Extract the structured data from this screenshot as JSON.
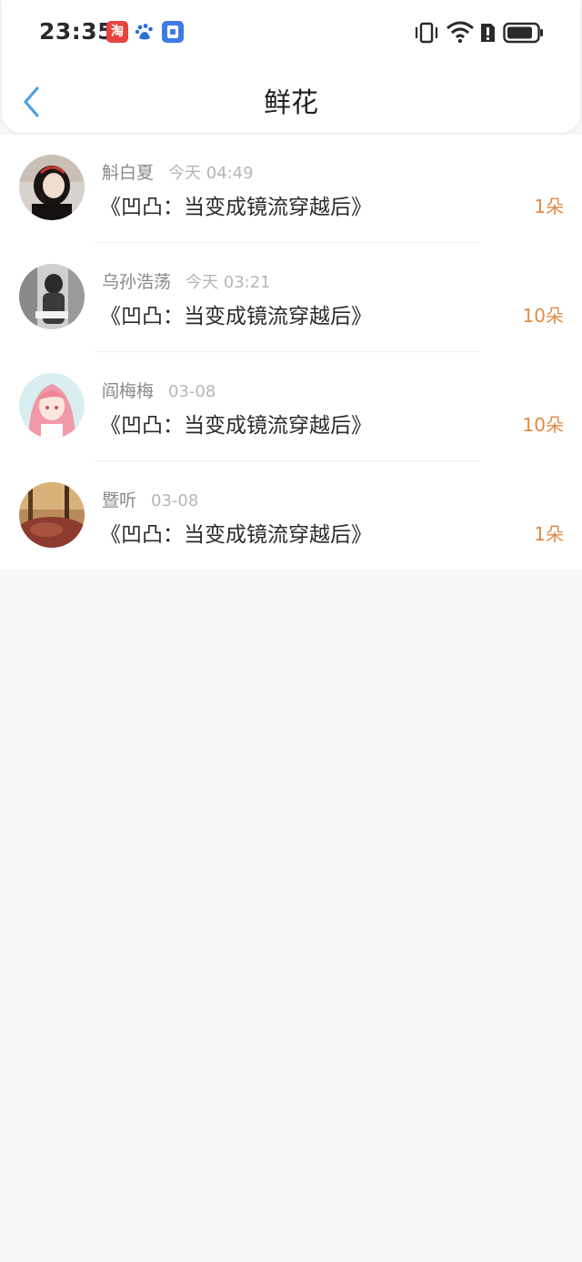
{
  "status_bar": {
    "time": "23:35",
    "app_icons": [
      "taobao-icon",
      "baidu-icon",
      "wallet-icon"
    ],
    "system_icons": [
      "vibrate-icon",
      "wifi-icon",
      "alert-icon",
      "battery-icon"
    ]
  },
  "nav": {
    "title": "鲜花",
    "back_icon": "chevron-left-icon"
  },
  "colors": {
    "accent": "#4a9fe6",
    "count": "#e08a45",
    "background": "#f8f6f6"
  },
  "items": [
    {
      "name": "斛白夏",
      "time": "今天 04:49",
      "book": "《凹凸：当变成镜流穿越后》",
      "count": "1朵"
    },
    {
      "name": "乌孙浩荡",
      "time": "今天 03:21",
      "book": "《凹凸：当变成镜流穿越后》",
      "count": "10朵"
    },
    {
      "name": "阎梅梅",
      "time": "03-08",
      "book": "《凹凸：当变成镜流穿越后》",
      "count": "10朵"
    },
    {
      "name": "暨听",
      "time": "03-08",
      "book": "《凹凸：当变成镜流穿越后》",
      "count": "1朵"
    }
  ]
}
